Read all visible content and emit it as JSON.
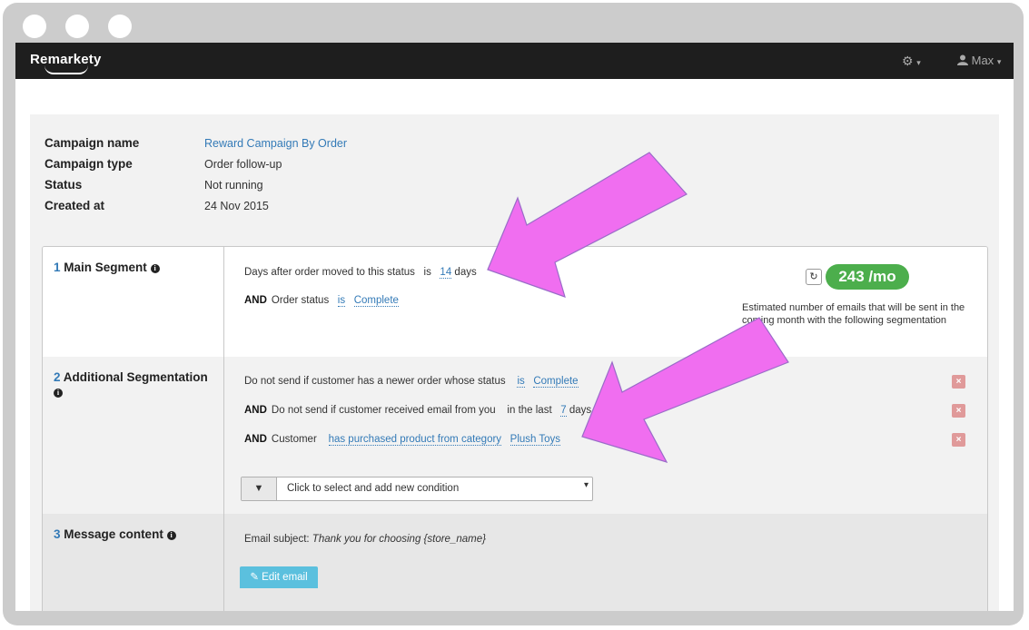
{
  "navbar": {
    "logo": "Remarkety",
    "settings_caret": "▾",
    "user_name": "Max",
    "user_caret": "▾"
  },
  "campaign": {
    "name_label": "Campaign name",
    "name_value": "Reward Campaign By Order",
    "type_label": "Campaign type",
    "type_value": "Order follow-up",
    "status_label": "Status",
    "status_value": "Not running",
    "created_label": "Created at",
    "created_value": "24 Nov 2015"
  },
  "sections": {
    "main": {
      "number": "1",
      "title": "Main Segment",
      "row1": {
        "text": "Days after order moved to this status",
        "op": "is",
        "value": "14",
        "unit": "days"
      },
      "row2": {
        "and": "AND",
        "text": "Order status",
        "op": "is",
        "value": "Complete"
      },
      "estimate_value": "243 /mo",
      "estimate_text": "Estimated number of emails that will be sent in the coming month with the following segmentation"
    },
    "additional": {
      "number": "2",
      "title": "Additional Segmentation",
      "row1": {
        "text": "Do not send if customer has a newer order whose status",
        "op": "is",
        "value": "Complete"
      },
      "row2": {
        "and": "AND",
        "text": "Do not send if customer received email from you",
        "op": "in the last",
        "value": "7",
        "unit": "days"
      },
      "row3": {
        "and": "AND",
        "text": "Customer",
        "op": "has purchased product from category",
        "value": "Plush Toys"
      },
      "remove_label": "×",
      "add_condition": "Click to select and add new condition"
    },
    "message": {
      "number": "3",
      "title": "Message content",
      "subject_label": "Email subject:",
      "subject_value": "Thank you for choosing {store_name}",
      "edit_button": "Edit email"
    }
  },
  "colors": {
    "navbar": "#1e1e1e",
    "link": "#337ab7",
    "badge": "#4cae4c",
    "arrow": "#f06ef0",
    "edit_button": "#5bc0de"
  },
  "icons": [
    "gear-icon",
    "user-icon",
    "info-icon",
    "refresh-icon",
    "filter-icon",
    "edit-icon",
    "remove-icon"
  ]
}
